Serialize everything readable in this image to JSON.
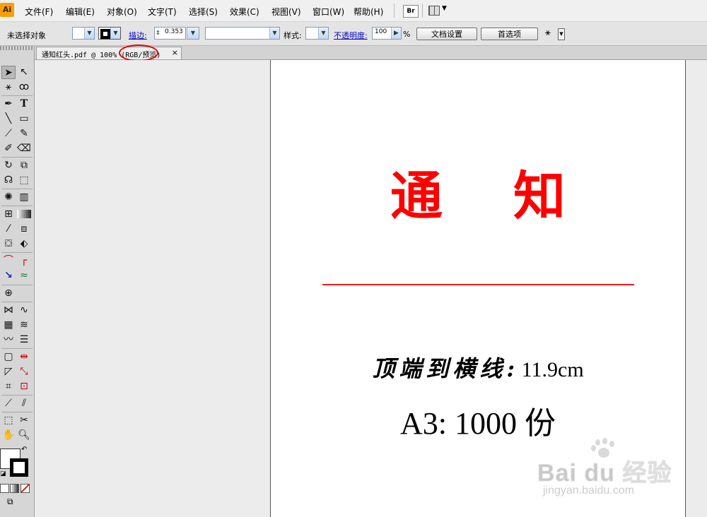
{
  "app": {
    "logo": "Ai"
  },
  "menu": {
    "items": [
      {
        "label": "文件(F)"
      },
      {
        "label": "编辑(E)"
      },
      {
        "label": "对象(O)"
      },
      {
        "label": "文字(T)"
      },
      {
        "label": "选择(S)"
      },
      {
        "label": "效果(C)"
      },
      {
        "label": "视图(V)"
      },
      {
        "label": "窗口(W)"
      },
      {
        "label": "帮助(H)"
      }
    ],
    "bridge_button": "Br"
  },
  "control_bar": {
    "selection_status": "未选择对象",
    "stroke_label": "描边:",
    "stroke_weight": "0.353",
    "style_label": "样式:",
    "opacity_label": "不透明度:",
    "opacity_value": "100",
    "opacity_unit": "%",
    "doc_setup_button": "文档设置",
    "preferences_button": "首选项"
  },
  "document_tab": {
    "title": "通知红头.pdf @ 100% (RGB/预览)",
    "close": "×"
  },
  "artboard": {
    "title": "通知",
    "top_line_label": "顶端到横线:",
    "top_line_value": "11.9cm",
    "quantity": "A3: 1000 份"
  },
  "watermark": {
    "logo": "Bai du 经验",
    "url": "jingyan.baidu.com"
  },
  "colors": {
    "title_red": "#ff0000",
    "annotation_red": "#e00000",
    "ai_logo_bg": "#f5a00a"
  }
}
